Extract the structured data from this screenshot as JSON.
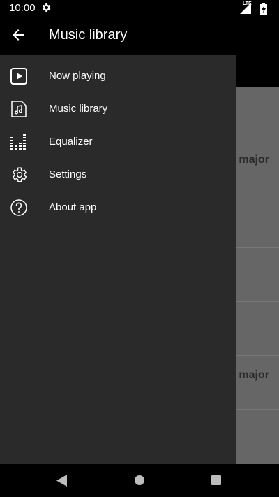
{
  "status_bar": {
    "time": "10:00",
    "network": "LTE",
    "icons": [
      "settings-gear-icon",
      "signal-icon",
      "battery-charging-icon"
    ]
  },
  "app_bar": {
    "title": "Music library",
    "back_icon": "arrow-back-icon"
  },
  "background_list": {
    "items": [
      {
        "text": ""
      },
      {
        "text": "major"
      },
      {
        "text": ""
      },
      {
        "text": ""
      },
      {
        "text": "major"
      },
      {
        "text": ""
      }
    ]
  },
  "drawer": {
    "items": [
      {
        "label": "Now playing",
        "icon": "play-icon"
      },
      {
        "label": "Music library",
        "icon": "music-file-icon"
      },
      {
        "label": "Equalizer",
        "icon": "equalizer-icon"
      },
      {
        "label": "Settings",
        "icon": "gear-icon"
      },
      {
        "label": "About app",
        "icon": "help-icon"
      }
    ]
  },
  "nav_bar": {
    "icons": [
      "back-triangle-icon",
      "home-circle-icon",
      "recents-square-icon"
    ]
  },
  "colors": {
    "drawer_bg": "#2a2a2a",
    "list_bg": "#666666",
    "bar_bg": "#000000",
    "text": "#ffffff"
  }
}
